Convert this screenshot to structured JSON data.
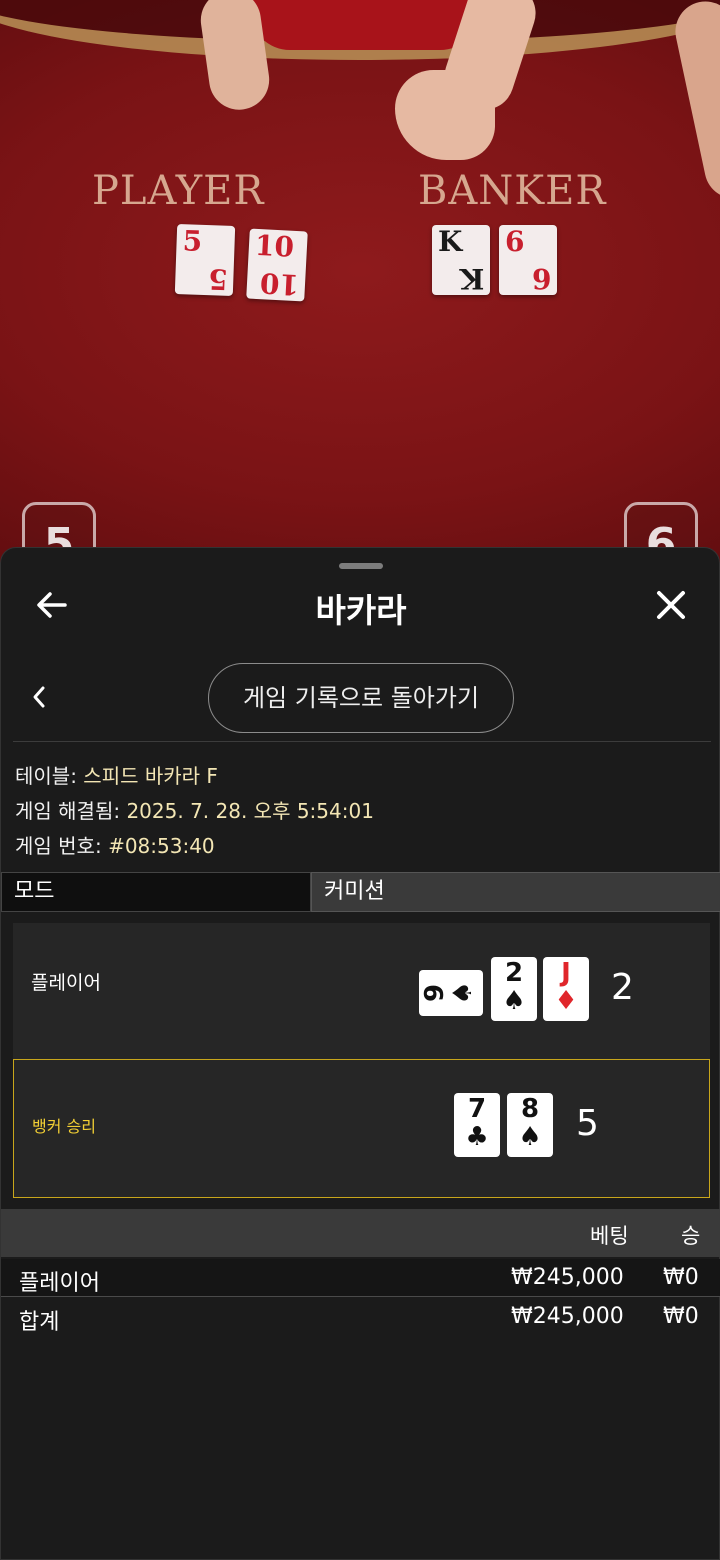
{
  "video": {
    "player_label": "PLAYER",
    "banker_label": "BANKER",
    "player_cards": [
      {
        "rank": "5",
        "suit": "♥"
      },
      {
        "rank": "10",
        "suit": "♥"
      }
    ],
    "banker_cards": [
      {
        "rank": "K",
        "suit": "♠"
      },
      {
        "rank": "6",
        "suit": "♦"
      }
    ],
    "left_marker": "5",
    "right_marker": "6"
  },
  "header": {
    "title": "바카라"
  },
  "nav": {
    "history_button": "게임 기록으로 돌아가기"
  },
  "info": {
    "table_label": "테이블: ",
    "table_value": "스피드 바카라 F",
    "resolved_label": "게임 해결됨: ",
    "resolved_value": "2025. 7. 28. 오후 5:54:01",
    "game_no_label": "게임 번호: ",
    "game_no_value": "#08:53:40"
  },
  "tabs": {
    "mode": "모드",
    "commission": "커미션"
  },
  "result": {
    "player": {
      "label": "플레이어",
      "score": "2",
      "cards": [
        {
          "rank": "9",
          "suit": "♠",
          "color": "black",
          "sideways": true
        },
        {
          "rank": "2",
          "suit": "♠",
          "color": "black"
        },
        {
          "rank": "J",
          "suit": "♦",
          "color": "red"
        }
      ]
    },
    "banker": {
      "label": "뱅커 승리",
      "score": "5",
      "cards": [
        {
          "rank": "7",
          "suit": "♣",
          "color": "black"
        },
        {
          "rank": "8",
          "suit": "♠",
          "color": "black"
        }
      ]
    }
  },
  "bets": {
    "col_bet": "베팅",
    "col_win": "승",
    "rows": [
      {
        "name": "플레이어",
        "bet": "₩245,000",
        "win": "₩0"
      },
      {
        "name": "합계",
        "bet": "₩245,000",
        "win": "₩0"
      }
    ]
  },
  "colors": {
    "accent_gold": "#f2cf34",
    "value_cream": "#f3e6b4",
    "card_red": "#e0262b"
  }
}
